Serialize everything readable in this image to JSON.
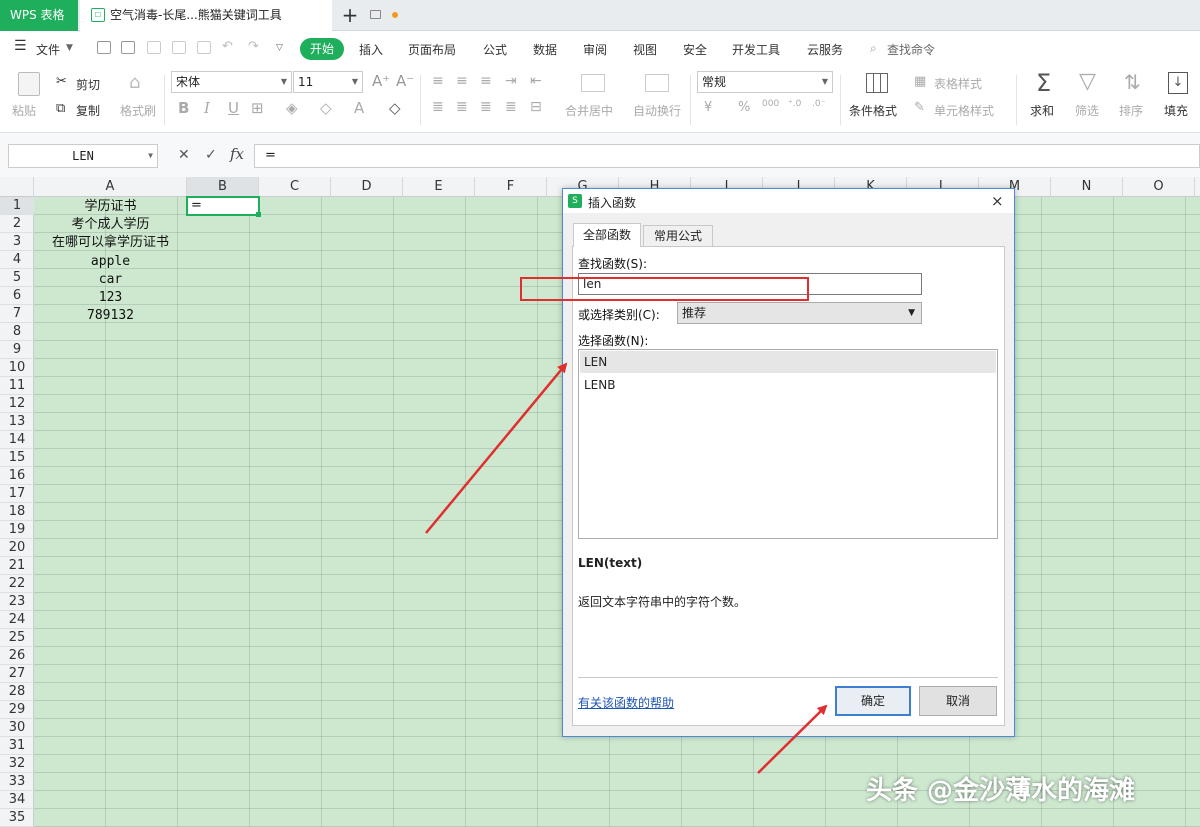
{
  "tabbar": {
    "app_label": "WPS 表格",
    "doc_label": "空气消毒-长尾...熊猫关键词工具",
    "new_tab": "+"
  },
  "menu": {
    "file": "文件",
    "items": [
      "开始",
      "插入",
      "页面布局",
      "公式",
      "数据",
      "审阅",
      "视图",
      "安全",
      "开发工具",
      "云服务"
    ],
    "search": "查找命令"
  },
  "toolbar": {
    "paste": "粘贴",
    "cut": "剪切",
    "copy": "复制",
    "format_painter": "格式刷",
    "font_name": "宋体",
    "font_size": "11",
    "merge": "合并居中",
    "wrap": "自动换行",
    "number_format": "常规",
    "cond_format": "条件格式",
    "table_style": "表格样式",
    "cell_style": "单元格样式",
    "sum": "求和",
    "filter": "筛选",
    "sort": "排序",
    "fill": "填充",
    "bold": "B",
    "italic": "I",
    "underline": "U",
    "percent": "%",
    "thousands": "000"
  },
  "formula_bar": {
    "name_box": "LEN",
    "formula": "="
  },
  "sheet": {
    "columns": [
      "A",
      "B",
      "C",
      "D",
      "E",
      "F",
      "G",
      "H",
      "I",
      "J",
      "K",
      "L",
      "M",
      "N",
      "O"
    ],
    "rows": [
      "1",
      "2",
      "3",
      "4",
      "5",
      "6",
      "7",
      "8",
      "9",
      "10",
      "11",
      "12",
      "13",
      "14",
      "15",
      "16",
      "17",
      "18",
      "19",
      "20",
      "21",
      "22",
      "23",
      "24",
      "25",
      "26",
      "27",
      "28",
      "29",
      "30",
      "31",
      "32",
      "33",
      "34",
      "35"
    ],
    "col_a": [
      "学历证书",
      "考个成人学历",
      "在哪可以拿学历证书",
      "apple",
      "car",
      "123",
      "789132"
    ],
    "b1": "="
  },
  "dialog": {
    "title": "插入函数",
    "tab_all": "全部函数",
    "tab_common": "常用公式",
    "search_label": "查找函数(S):",
    "search_value": "len",
    "category_label": "或选择类别(C):",
    "category_value": "推荐",
    "select_label": "选择函数(N):",
    "functions": [
      "LEN",
      "LENB"
    ],
    "signature": "LEN(text)",
    "description": "返回文本字符串中的字符个数。",
    "help_link": "有关该函数的帮助",
    "ok": "确定",
    "cancel": "取消",
    "close": "×"
  },
  "watermark": "头条 @金沙薄水的海滩",
  "colors": {
    "accent": "#1fae5c",
    "sheet_bg": "#cde8cf",
    "annotation": "#e02f2f",
    "link": "#1e55b3"
  }
}
